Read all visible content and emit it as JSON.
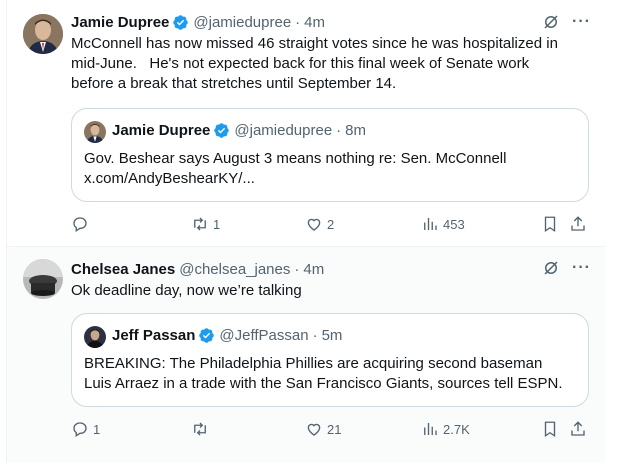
{
  "tweets": [
    {
      "name": "Jamie Dupree",
      "handle": "@jamiedupree",
      "time": "4m",
      "text": "McConnell has now missed 46 straight votes since he was hospitalized in\nmid-June.   He's not expected back for this final week of Senate work\nbefore a break that stretches until September 14.",
      "quote": {
        "name": "Jamie Dupree",
        "handle": "@jamiedupree",
        "time": "8m",
        "lines": [
          "Gov. Beshear says August 3 means nothing re: Sen. McConnell",
          "x.com/AndyBeshearKY/..."
        ]
      },
      "stats": {
        "replies": "",
        "reposts": "1",
        "likes": "2",
        "views": "453"
      }
    },
    {
      "name": "Chelsea Janes",
      "handle": "@chelsea_janes",
      "time": "4m",
      "text": "Ok deadline day, now we’re talking",
      "quote": {
        "name": "Jeff Passan",
        "handle": "@JeffPassan",
        "time": "5m",
        "lines": [
          "BREAKING: The Philadelphia Phillies are acquiring second baseman",
          "Luis Arraez in a trade with the San Francisco Giants, sources tell ESPN."
        ]
      },
      "stats": {
        "replies": "1",
        "reposts": "",
        "likes": "21",
        "views": "2.7K"
      }
    }
  ],
  "separator": "·",
  "icons": {
    "verified": "verified-badge-icon",
    "grok": "grok-icon",
    "more": "more-icon",
    "reply": "reply-icon",
    "repost": "repost-icon",
    "like": "heart-icon",
    "views": "views-icon",
    "bookmark": "bookmark-icon",
    "share": "share-icon"
  },
  "colors": {
    "verified": "#1d9bf0",
    "secondary_text": "#536471",
    "border": "#cfd9de"
  }
}
